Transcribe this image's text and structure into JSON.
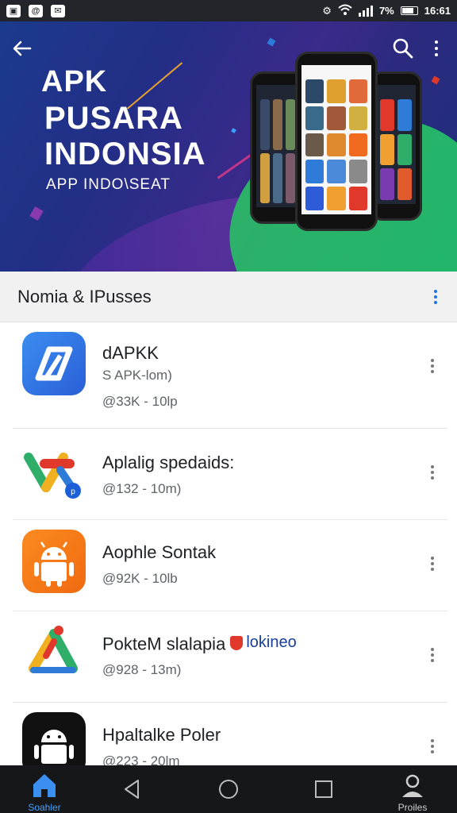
{
  "status_bar": {
    "time": "16:61",
    "battery_percent": "7%",
    "left_icons": [
      "notification-icon",
      "at-icon",
      "mail-icon"
    ],
    "right_icons": [
      "settings-icon",
      "wifi-icon",
      "signal-icon",
      "battery-icon"
    ]
  },
  "hero": {
    "brand": "APK",
    "title_line1": "PUSARA",
    "title_line2": "INDONSIA",
    "subtitle": "APP INDO\\SEAT"
  },
  "section": {
    "title": "Nomia & IPusses"
  },
  "apps": [
    {
      "name": "dAPKK",
      "meta1": "S APK-lom)",
      "meta2": "@33K - 10lp"
    },
    {
      "name": "Aplalig spedaids:",
      "meta1": "@132 - 10m)"
    },
    {
      "name": "Aophle Sontak",
      "meta1": "@92K - 10lb"
    },
    {
      "name": "PokteM slalapia",
      "badge": "lokineo",
      "meta1": "@928 - 13m)"
    },
    {
      "name": "Hpaltalke Poler",
      "meta1": "@223 - 20lm"
    }
  ],
  "bottom_nav": {
    "home_label": "Soahler",
    "profile_label": "Proiles"
  },
  "colors": {
    "accent": "#1a73e8",
    "hero_bg": "#232e86",
    "hero_green": "#2fae6a",
    "nav_bg": "#151719"
  }
}
